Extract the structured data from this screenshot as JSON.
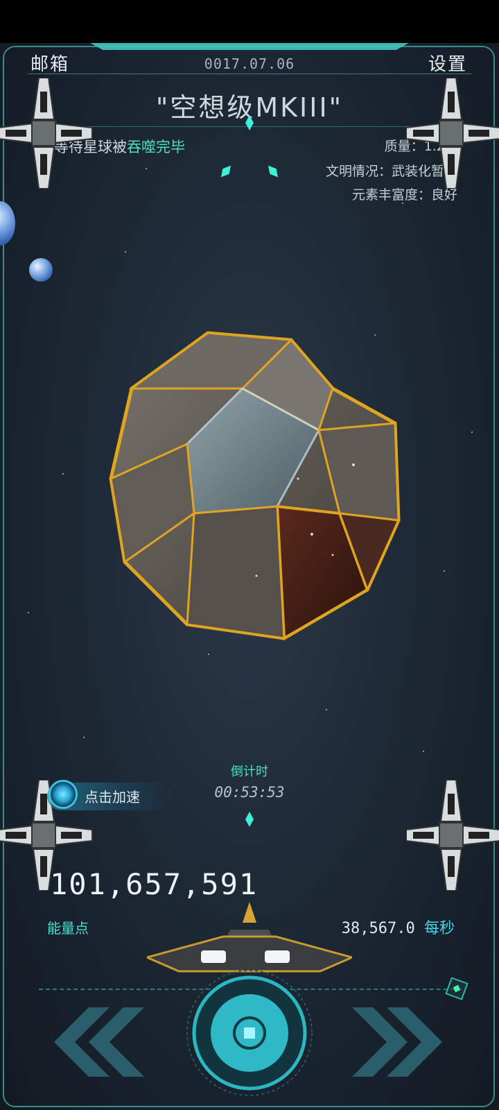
{
  "header": {
    "mailbox_label": "邮箱",
    "settings_label": "设置",
    "date": "0017.07.06"
  },
  "ship": {
    "name": "\"空想级MKIII\""
  },
  "status": {
    "prefix": "等待星球被",
    "highlight": "吞噬完毕"
  },
  "planet_info": {
    "mass": "质量：1.2...",
    "civilization": "文明情况：武装化暂停",
    "element_abundance": "元素丰富度：良好"
  },
  "boost": {
    "label": "点击加速"
  },
  "countdown": {
    "label": "倒计时",
    "value": "00:53:53"
  },
  "energy": {
    "total": "101,657,591",
    "label": "能量点",
    "rate_value": "38,567.0",
    "rate_unit": "每秒"
  },
  "colors": {
    "accent_teal": "#48e3b8",
    "frame": "#3c8c8a",
    "button_core": "#2fb8c6"
  }
}
